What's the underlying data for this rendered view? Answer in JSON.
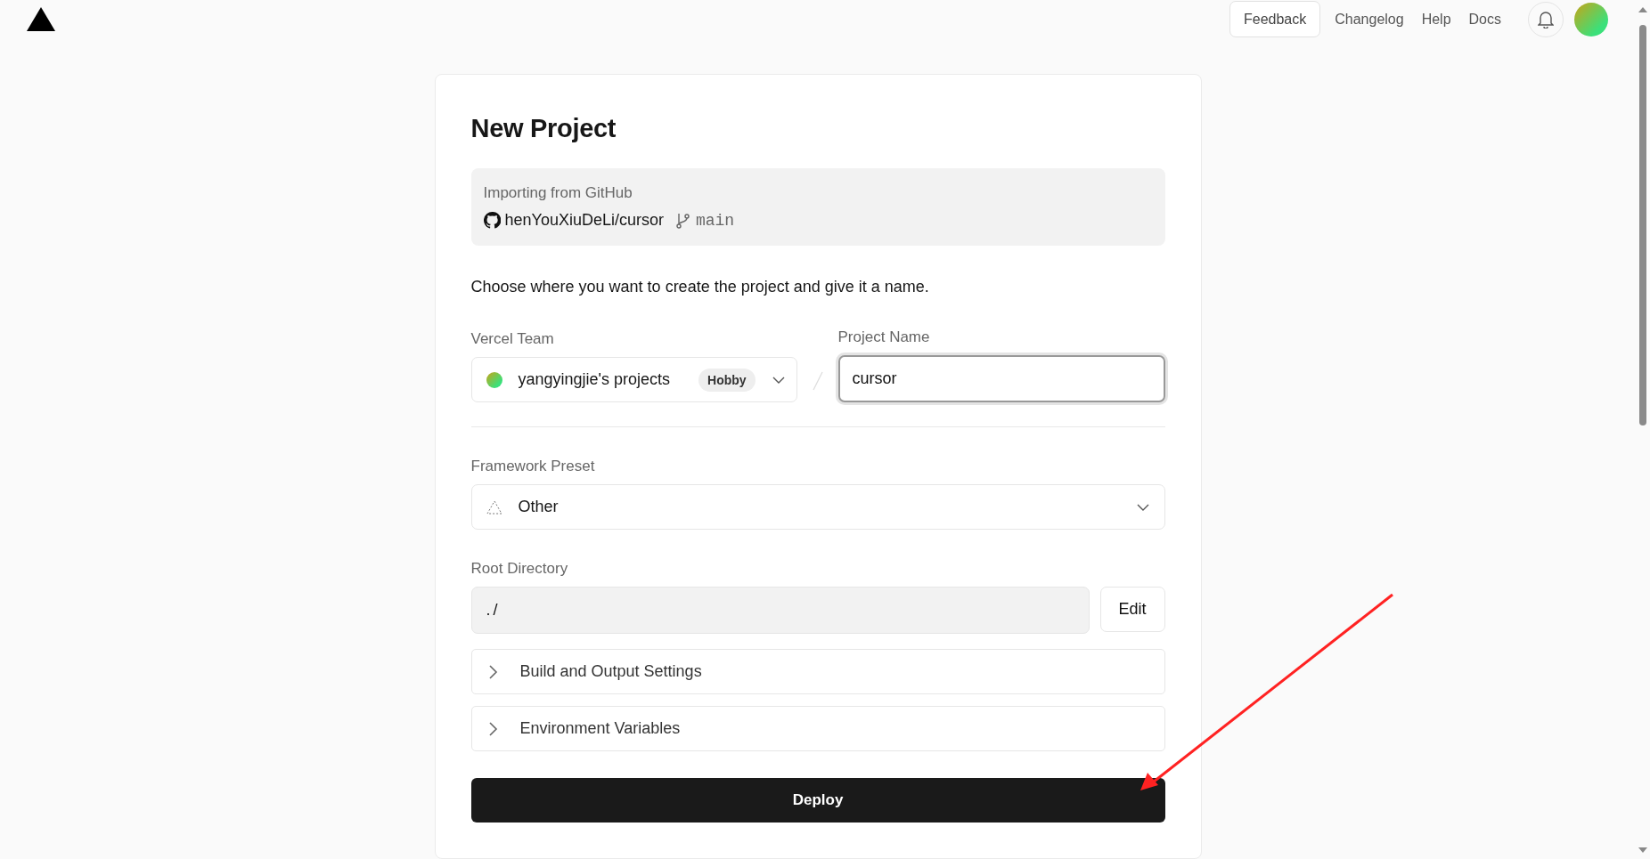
{
  "header": {
    "links": [
      {
        "label": "Feedback",
        "kind": "button"
      },
      {
        "label": "Changelog",
        "kind": "link"
      },
      {
        "label": "Help",
        "kind": "link"
      },
      {
        "label": "Docs",
        "kind": "link"
      }
    ]
  },
  "title": "New Project",
  "import": {
    "label": "Importing from GitHub",
    "repo": "henYouXiuDeLi/cursor",
    "branch": "main"
  },
  "instructions": "Choose where you want to create the project and give it a name.",
  "team": {
    "label": "Vercel Team",
    "value": "yangyingjie's projects",
    "badge": "Hobby"
  },
  "project_name": {
    "label": "Project Name",
    "value": "cursor"
  },
  "framework": {
    "label": "Framework Preset",
    "value": "Other"
  },
  "root_directory": {
    "label": "Root Directory",
    "value": "./",
    "button": "Edit"
  },
  "sections": [
    {
      "label": "Build and Output Settings",
      "expanded": false
    },
    {
      "label": "Environment Variables",
      "expanded": false
    }
  ],
  "deploy": "Deploy"
}
